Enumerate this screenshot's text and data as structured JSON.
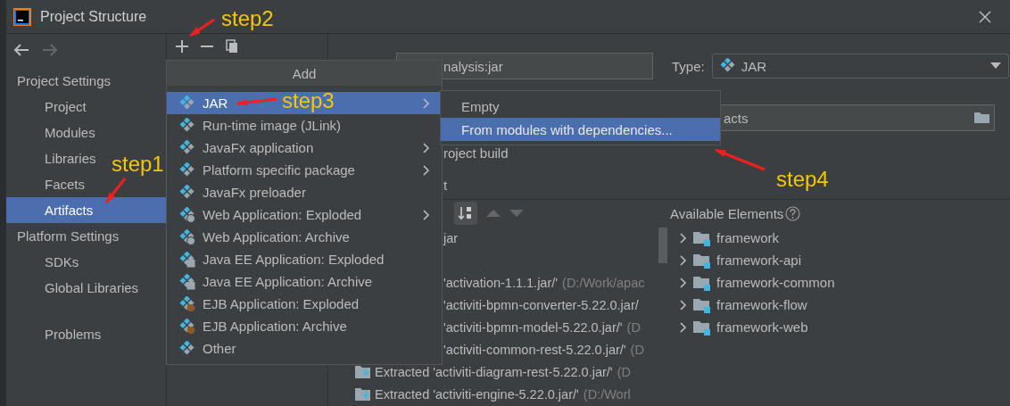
{
  "window": {
    "title": "Project Structure"
  },
  "sidebar": {
    "groups": [
      {
        "title": "Project Settings",
        "items": [
          {
            "label": "Project",
            "selected": false
          },
          {
            "label": "Modules",
            "selected": false
          },
          {
            "label": "Libraries",
            "selected": false
          },
          {
            "label": "Facets",
            "selected": false
          },
          {
            "label": "Artifacts",
            "selected": true
          }
        ]
      },
      {
        "title": "Platform Settings",
        "items": [
          {
            "label": "SDKs",
            "selected": false
          },
          {
            "label": "Global Libraries",
            "selected": false
          }
        ]
      }
    ],
    "extra_items": [
      {
        "label": "Problems",
        "selected": false
      }
    ]
  },
  "artifact": {
    "name": "nalysis:jar",
    "type_label": "Type:",
    "type": "JAR",
    "output_directory": "acts",
    "include_in_build": "roject build",
    "layout_tab": "t",
    "layout_rows": [
      {
        "kind": "clipped",
        "name": "jar"
      },
      {
        "kind": "clipped",
        "name": "'activation-1.1.1.jar/'",
        "path": "(D:/Work/apac"
      },
      {
        "kind": "clipped",
        "name": "'activiti-bpmn-converter-5.22.0.jar/"
      },
      {
        "kind": "clipped",
        "name": "'activiti-bpmn-model-5.22.0.jar/'",
        "path": "(D"
      },
      {
        "kind": "clipped",
        "name": "'activiti-common-rest-5.22.0.jar/'",
        "path": "(D"
      },
      {
        "kind": "extracted",
        "name": "Extracted 'activiti-diagram-rest-5.22.0.jar/'",
        "path": "(D"
      },
      {
        "kind": "extracted",
        "name": "Extracted 'activiti-engine-5.22.0.jar/'",
        "path": "(D:/Worl"
      }
    ],
    "available_title": "Available Elements",
    "available": [
      {
        "label": "framework",
        "expanded": false
      },
      {
        "label": "framework-api",
        "expanded": false
      },
      {
        "label": "framework-common",
        "expanded": false
      },
      {
        "label": "framework-flow",
        "expanded": false
      },
      {
        "label": "framework-web",
        "expanded": false
      }
    ]
  },
  "add_menu": {
    "title": "Add",
    "items": [
      {
        "label": "JAR",
        "kind": "plain",
        "submenu": true,
        "selected": true
      },
      {
        "label": "Run-time image (JLink)",
        "kind": "plain",
        "submenu": false,
        "selected": false
      },
      {
        "label": "JavaFx application",
        "kind": "plain",
        "submenu": true,
        "selected": false
      },
      {
        "label": "Platform specific package",
        "kind": "plain",
        "submenu": true,
        "selected": false
      },
      {
        "label": "JavaFx preloader",
        "kind": "plain",
        "submenu": false,
        "selected": false
      },
      {
        "label": "Web Application: Exploded",
        "kind": "web",
        "submenu": true,
        "selected": false
      },
      {
        "label": "Web Application: Archive",
        "kind": "web",
        "submenu": false,
        "selected": false
      },
      {
        "label": "Java EE Application: Exploded",
        "kind": "javaee",
        "submenu": false,
        "selected": false
      },
      {
        "label": "Java EE Application: Archive",
        "kind": "javaee",
        "submenu": false,
        "selected": false
      },
      {
        "label": "EJB Application: Exploded",
        "kind": "ejb",
        "submenu": false,
        "selected": false
      },
      {
        "label": "EJB Application: Archive",
        "kind": "ejb",
        "submenu": false,
        "selected": false
      },
      {
        "label": "Other",
        "kind": "plain",
        "submenu": false,
        "selected": false
      }
    ]
  },
  "jar_submenu": [
    {
      "label": "Empty",
      "selected": false
    },
    {
      "label": "From modules with dependencies...",
      "selected": true
    }
  ],
  "annotations": [
    {
      "label": "step2"
    },
    {
      "label": "step3"
    },
    {
      "label": "step1"
    },
    {
      "label": "step4"
    }
  ]
}
